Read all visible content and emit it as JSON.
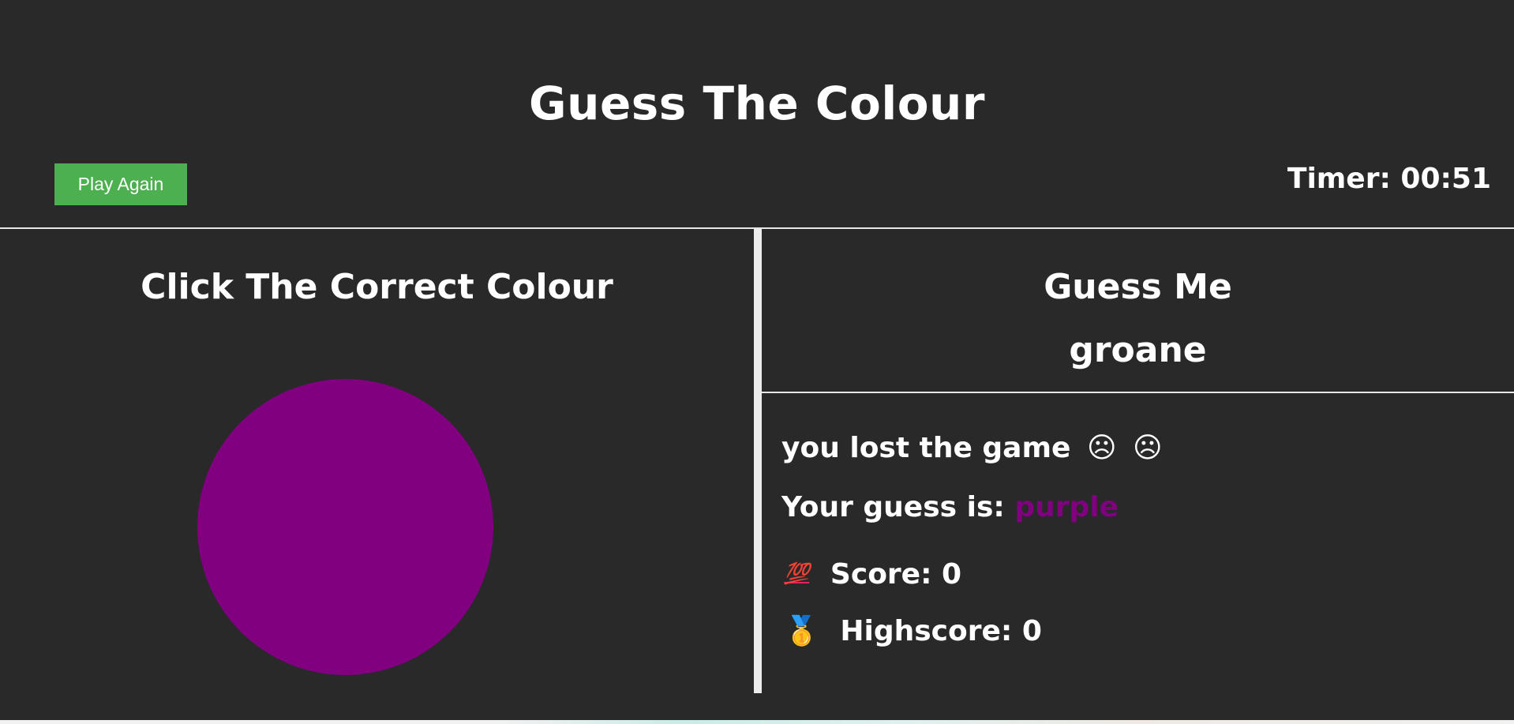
{
  "header": {
    "title": "Guess The Colour",
    "play_again_label": "Play Again",
    "timer_text": "Timer: 00:51"
  },
  "left_panel": {
    "heading": "Click The Correct Colour",
    "circle_color": "#800080"
  },
  "right_panel": {
    "label": "Guess Me",
    "target_word": "groane",
    "status_text": "you lost the game",
    "status_emoji": "☹",
    "guess_prefix": "Your guess is:",
    "guess_value": "purple",
    "guess_color": "#800080",
    "score_emoji": "💯",
    "score_text": "Score: 0",
    "highscore_emoji": "🥇",
    "highscore_text": "Highscore: 0"
  },
  "colors": {
    "background": "#292929",
    "button": "#4caf50",
    "text": "#ffffff"
  }
}
